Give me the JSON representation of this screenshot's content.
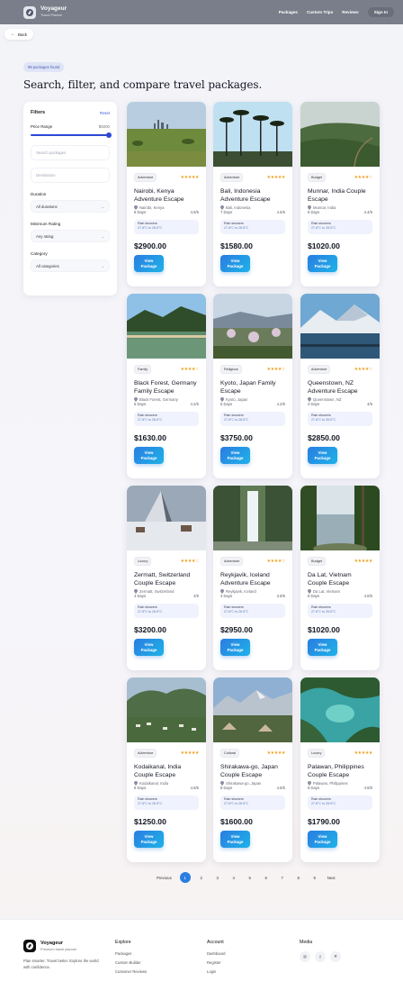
{
  "header": {
    "brand": "Voyageur",
    "brand_sub": "Travel Planner",
    "nav": [
      "Packages",
      "Custom Trips",
      "Reviews"
    ],
    "signin": "Sign In"
  },
  "back_label": "Back",
  "results_count": "98 packages found",
  "page_title": "Search, filter, and compare travel packages.",
  "filters": {
    "title": "Filters",
    "reset": "Reset",
    "price_label": "Price Range",
    "price_max": "$5000",
    "price_level": 1.0,
    "search_placeholder": "Search packages",
    "destination_placeholder": "Destination",
    "duration_label": "Duration",
    "duration_value": "All durations",
    "rating_label": "Minimum Rating",
    "rating_value": "Any rating",
    "category_label": "Category",
    "category_value": "All categories"
  },
  "common": {
    "weather_title": "Rain showers",
    "weather_range": "27.8°C to 28.5°C",
    "view_line1": "View",
    "view_line2": "Package"
  },
  "packages": [
    {
      "tag": "Adventure",
      "stars": "★★★★★",
      "title": "Nairobi, Kenya Adventure Escape",
      "location": "Nairobi, Kenya",
      "days": "8 Days",
      "rating": "4.8/5",
      "price": "$2900.00"
    },
    {
      "tag": "Adventure",
      "stars": "★★★★★",
      "title": "Bali, Indonesia Adventure Escape",
      "location": "Bali, Indonesia",
      "days": "7 Days",
      "rating": "4.6/5",
      "price": "$1580.00"
    },
    {
      "tag": "Budget",
      "stars": "★★★★☆",
      "title": "Munnar, India Couple Escape",
      "location": "Munnar, India",
      "days": "6 Days",
      "rating": "4.4/5",
      "price": "$1020.00"
    },
    {
      "tag": "Family",
      "stars": "★★★★☆",
      "title": "Black Forest, Germany Family Escape",
      "location": "Black Forest, Germany",
      "days": "5 Days",
      "rating": "4.2/5",
      "price": "$1630.00"
    },
    {
      "tag": "Religious",
      "stars": "★★★★☆",
      "title": "Kyoto, Japan Family Escape",
      "location": "Kyoto, Japan",
      "days": "5 Days",
      "rating": "4.2/5",
      "price": "$3750.00"
    },
    {
      "tag": "Adventure",
      "stars": "★★★★☆",
      "title": "Queenstown, NZ Adventure Escape",
      "location": "Queenstown, NZ",
      "days": "4 Days",
      "rating": "4/5",
      "price": "$2850.00"
    },
    {
      "tag": "Luxury",
      "stars": "★★★★☆",
      "title": "Zermatt, Switzerland Couple Escape",
      "location": "Zermatt, Switzerland",
      "days": "4 Days",
      "rating": "4/5",
      "price": "$3200.00"
    },
    {
      "tag": "Adventure",
      "stars": "★★★★☆",
      "title": "Reykjavik, Iceland Adventure Escape",
      "location": "Reykjavik, Iceland",
      "days": "3 Days",
      "rating": "3.8/5",
      "price": "$2950.00"
    },
    {
      "tag": "Budget",
      "stars": "★★★★★",
      "title": "Da Lat, Vietnam Couple Escape",
      "location": "Da Lat, Vietnam",
      "days": "8 Days",
      "rating": "4.8/5",
      "price": "$1020.00"
    },
    {
      "tag": "Adventure",
      "stars": "★★★★★",
      "title": "Kodaikanal, India Couple Escape",
      "location": "Kodaikanal, India",
      "days": "8 Days",
      "rating": "4.8/5",
      "price": "$1250.00"
    },
    {
      "tag": "Cultural",
      "stars": "★★★★★",
      "title": "Shirakawa-go, Japan Couple Escape",
      "location": "Shirakawa-go, Japan",
      "days": "8 Days",
      "rating": "4.8/5",
      "price": "$1600.00"
    },
    {
      "tag": "Luxury",
      "stars": "★★★★★",
      "title": "Palawan, Philippines Couple Escape",
      "location": "Palawan, Philippines",
      "days": "8 Days",
      "rating": "4.8/5",
      "price": "$1790.00"
    }
  ],
  "pagination": {
    "previous": "Previous",
    "pages": [
      "1",
      "2",
      "3",
      "4",
      "5",
      "6",
      "7",
      "8",
      "9"
    ],
    "current": "1",
    "next": "Next"
  },
  "footer": {
    "brand": "Voyageur",
    "tagline": "Premium travel planner",
    "description": "Plan smarter. Travel better. Explore the world with confidence.",
    "explore_title": "Explore",
    "explore_links": [
      "Packages",
      "Custom Builder",
      "Customer Reviews"
    ],
    "account_title": "Account",
    "account_links": [
      "Dashboard",
      "Register",
      "Login"
    ],
    "media_title": "Media",
    "socials": [
      "instagram-icon",
      "facebook-icon",
      "x-icon"
    ]
  },
  "colors": {
    "accent": "#2a7de1",
    "header_bg": "#7a7d8a",
    "star": "#f0a020"
  }
}
